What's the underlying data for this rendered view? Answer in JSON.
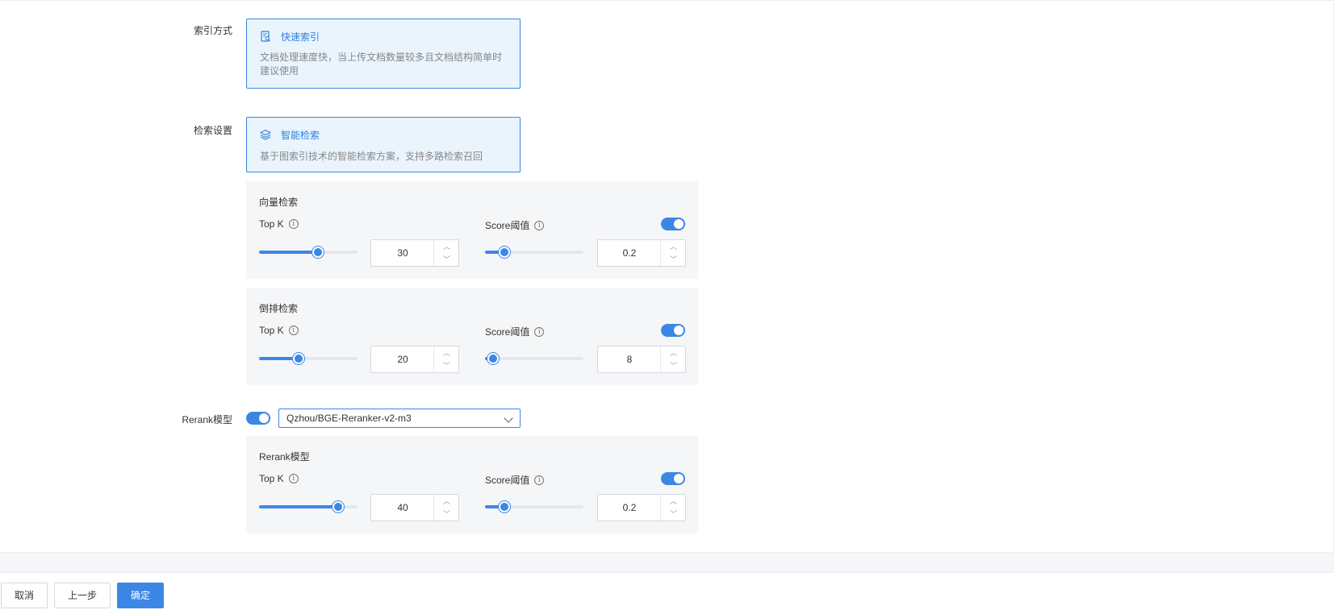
{
  "index": {
    "label": "索引方式",
    "card": {
      "icon": "document-search-icon",
      "title": "快速索引",
      "desc_line1": "文档处理速度快，当上传文档数量较多且文档结构简单时",
      "desc_line2": "建议使用"
    }
  },
  "retrieval": {
    "label": "检索设置",
    "card": {
      "icon": "layers-icon",
      "title": "智能检索",
      "desc": "基于图索引技术的智能检索方案，支持多路检索召回"
    },
    "vector": {
      "title": "向量检索",
      "topk_label": "Top K",
      "topk_value": "30",
      "topk_fraction": 0.6,
      "score_label": "Score阈值",
      "score_value": "0.2",
      "score_fraction": 0.2,
      "score_enabled": true
    },
    "inverted": {
      "title": "倒排检索",
      "topk_label": "Top K",
      "topk_value": "20",
      "topk_fraction": 0.4,
      "score_label": "Score阈值",
      "score_value": "8",
      "score_fraction": 0.08,
      "score_enabled": true
    }
  },
  "rerank": {
    "label": "Rerank模型",
    "enabled": true,
    "model": "Qzhou/BGE-Reranker-v2-m3",
    "panel": {
      "title": "Rerank模型",
      "topk_label": "Top K",
      "topk_value": "40",
      "topk_fraction": 0.8,
      "score_label": "Score阈值",
      "score_value": "0.2",
      "score_fraction": 0.2,
      "score_enabled": true
    }
  },
  "footer": {
    "cancel": "取消",
    "prev": "上一步",
    "confirm": "确定"
  },
  "colors": {
    "accent": "#3b87e6",
    "card_bg": "#e9f4fd",
    "panel_bg": "#f5f6f8"
  }
}
